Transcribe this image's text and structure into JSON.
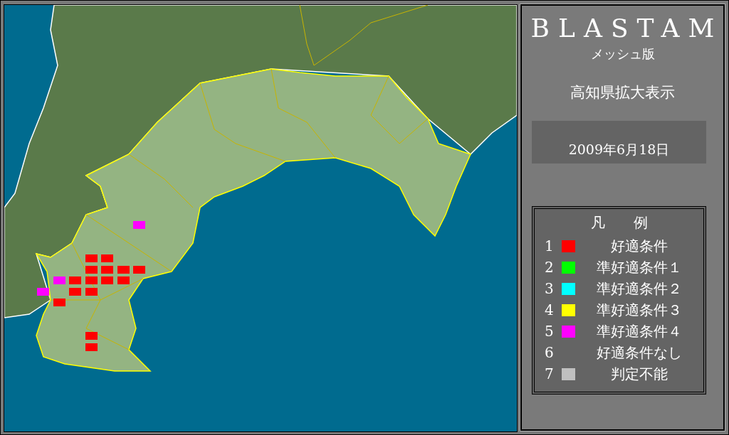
{
  "panel": {
    "title": "BLASTAM",
    "subtitle": "メッシュ版",
    "view": "高知県拡大表示",
    "date": "2009年6月18日"
  },
  "legend": {
    "title": "凡　　例",
    "items": [
      {
        "number": "1",
        "label": "好適条件",
        "color": "#ff0000"
      },
      {
        "number": "2",
        "label": "準好適条件１",
        "color": "#00ff00"
      },
      {
        "number": "3",
        "label": "準好適条件２",
        "color": "#00ffff"
      },
      {
        "number": "4",
        "label": "準好適条件３",
        "color": "#ffff00"
      },
      {
        "number": "5",
        "label": "準好適条件４",
        "color": "#ff00ff"
      },
      {
        "number": "6",
        "label": "好適条件なし"
      },
      {
        "number": "7",
        "label": "判定不能",
        "color": "#c0c0c0"
      }
    ]
  }
}
